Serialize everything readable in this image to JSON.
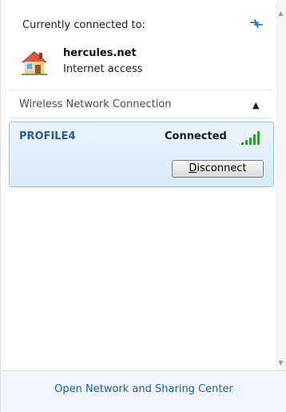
{
  "connection": {
    "header": "Currently connected to:",
    "network_name": "hercules.net",
    "network_access": "Internet access"
  },
  "wireless_section": {
    "title": "Wireless Network Connection",
    "profile": {
      "name": "PROFILE4",
      "status": "Connected",
      "signal_bars": 5,
      "disconnect_label_rest": "isconnect",
      "disconnect_label_mnemonic": "D"
    }
  },
  "footer": {
    "link": "Open Network and Sharing Center"
  },
  "icons": {
    "refresh": "refresh-arrows-icon",
    "network_home": "house-network-icon",
    "collapse": "chevron-up-icon",
    "signal": "signal-strength-icon"
  },
  "colors": {
    "profile_name": "#2b5aa6",
    "signal_green": "#2aa52a",
    "footer_link": "#1f5ea8",
    "selection_border": "#9ac4e6"
  }
}
